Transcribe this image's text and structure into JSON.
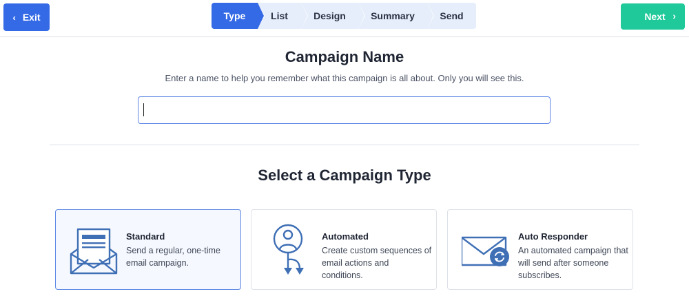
{
  "header": {
    "exit_label": "Exit",
    "exit_chevron": "‹",
    "next_label": "Next",
    "next_chevron": "›",
    "steps": [
      {
        "label": "Type",
        "active": true
      },
      {
        "label": "List",
        "active": false
      },
      {
        "label": "Design",
        "active": false
      },
      {
        "label": "Summary",
        "active": false
      },
      {
        "label": "Send",
        "active": false
      }
    ]
  },
  "campaign_name": {
    "heading": "Campaign Name",
    "helper": "Enter a name to help you remember what this campaign is all about. Only you will see this.",
    "value": "",
    "placeholder": ""
  },
  "campaign_type": {
    "heading": "Select a Campaign Type",
    "options": [
      {
        "title": "Standard",
        "description": "Send a regular, one-time email campaign.",
        "icon": "envelope-letter-icon",
        "selected": true
      },
      {
        "title": "Automated",
        "description": "Create custom sequences of email actions and conditions.",
        "icon": "user-branch-icon",
        "selected": false
      },
      {
        "title": "Auto Responder",
        "description": "An automated campaign that will send after someone subscribes.",
        "icon": "envelope-refresh-icon",
        "selected": false
      }
    ]
  },
  "colors": {
    "primary_blue": "#356ae6",
    "step_inactive": "#e6eefb",
    "next_green": "#1fc99a",
    "icon_blue": "#3f6fb5",
    "text_dark": "#1f2533"
  }
}
